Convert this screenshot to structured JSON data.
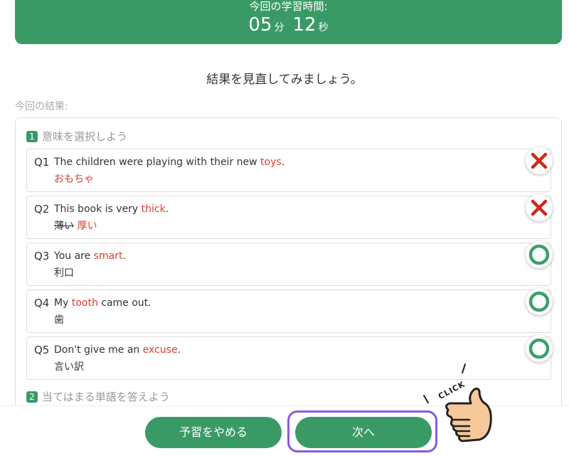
{
  "timer": {
    "label": "今回の学習時間:",
    "minutes": "05",
    "minutes_unit": "分",
    "seconds": "12",
    "seconds_unit": "秒"
  },
  "review_message": "結果を見直してみましょう。",
  "results_label": "今回の結果:",
  "sections": [
    {
      "number": "1",
      "title": "意味を選択しよう"
    },
    {
      "number": "2",
      "title": "当てはまる単語を答えよう"
    }
  ],
  "questions": [
    {
      "num": "Q1",
      "en_before": "The children were playing with their new ",
      "en_word": "toys",
      "en_after": ".",
      "ja_wrong": "",
      "ja_answer": "おもちゃ",
      "result": "incorrect"
    },
    {
      "num": "Q2",
      "en_before": "This book is very ",
      "en_word": "thick",
      "en_after": ".",
      "ja_wrong": "薄い",
      "ja_answer": "厚い",
      "result": "incorrect"
    },
    {
      "num": "Q3",
      "en_before": "You are ",
      "en_word": "smart",
      "en_after": ".",
      "ja_wrong": "",
      "ja_answer": "利口",
      "result": "correct"
    },
    {
      "num": "Q4",
      "en_before": "My ",
      "en_word": "tooth",
      "en_after": " came out.",
      "ja_wrong": "",
      "ja_answer": "歯",
      "result": "correct"
    },
    {
      "num": "Q5",
      "en_before": "Don't give me an ",
      "en_word": "excuse",
      "en_after": ".",
      "ja_wrong": "",
      "ja_answer": "言い訳",
      "result": "correct"
    }
  ],
  "buttons": {
    "quit": "予習をやめる",
    "next": "次へ"
  },
  "click_hint": "CLICK",
  "colors": {
    "brand_green": "#3a9a66",
    "highlight_red": "#d94030",
    "correct_green": "#3aa06a",
    "incorrect_red": "#cc2b1d",
    "focus_ring": "#8a5cd9"
  },
  "icons": {
    "correct": "circle-correct-icon",
    "incorrect": "cross-incorrect-icon",
    "pointer": "pointing-hand-icon"
  }
}
